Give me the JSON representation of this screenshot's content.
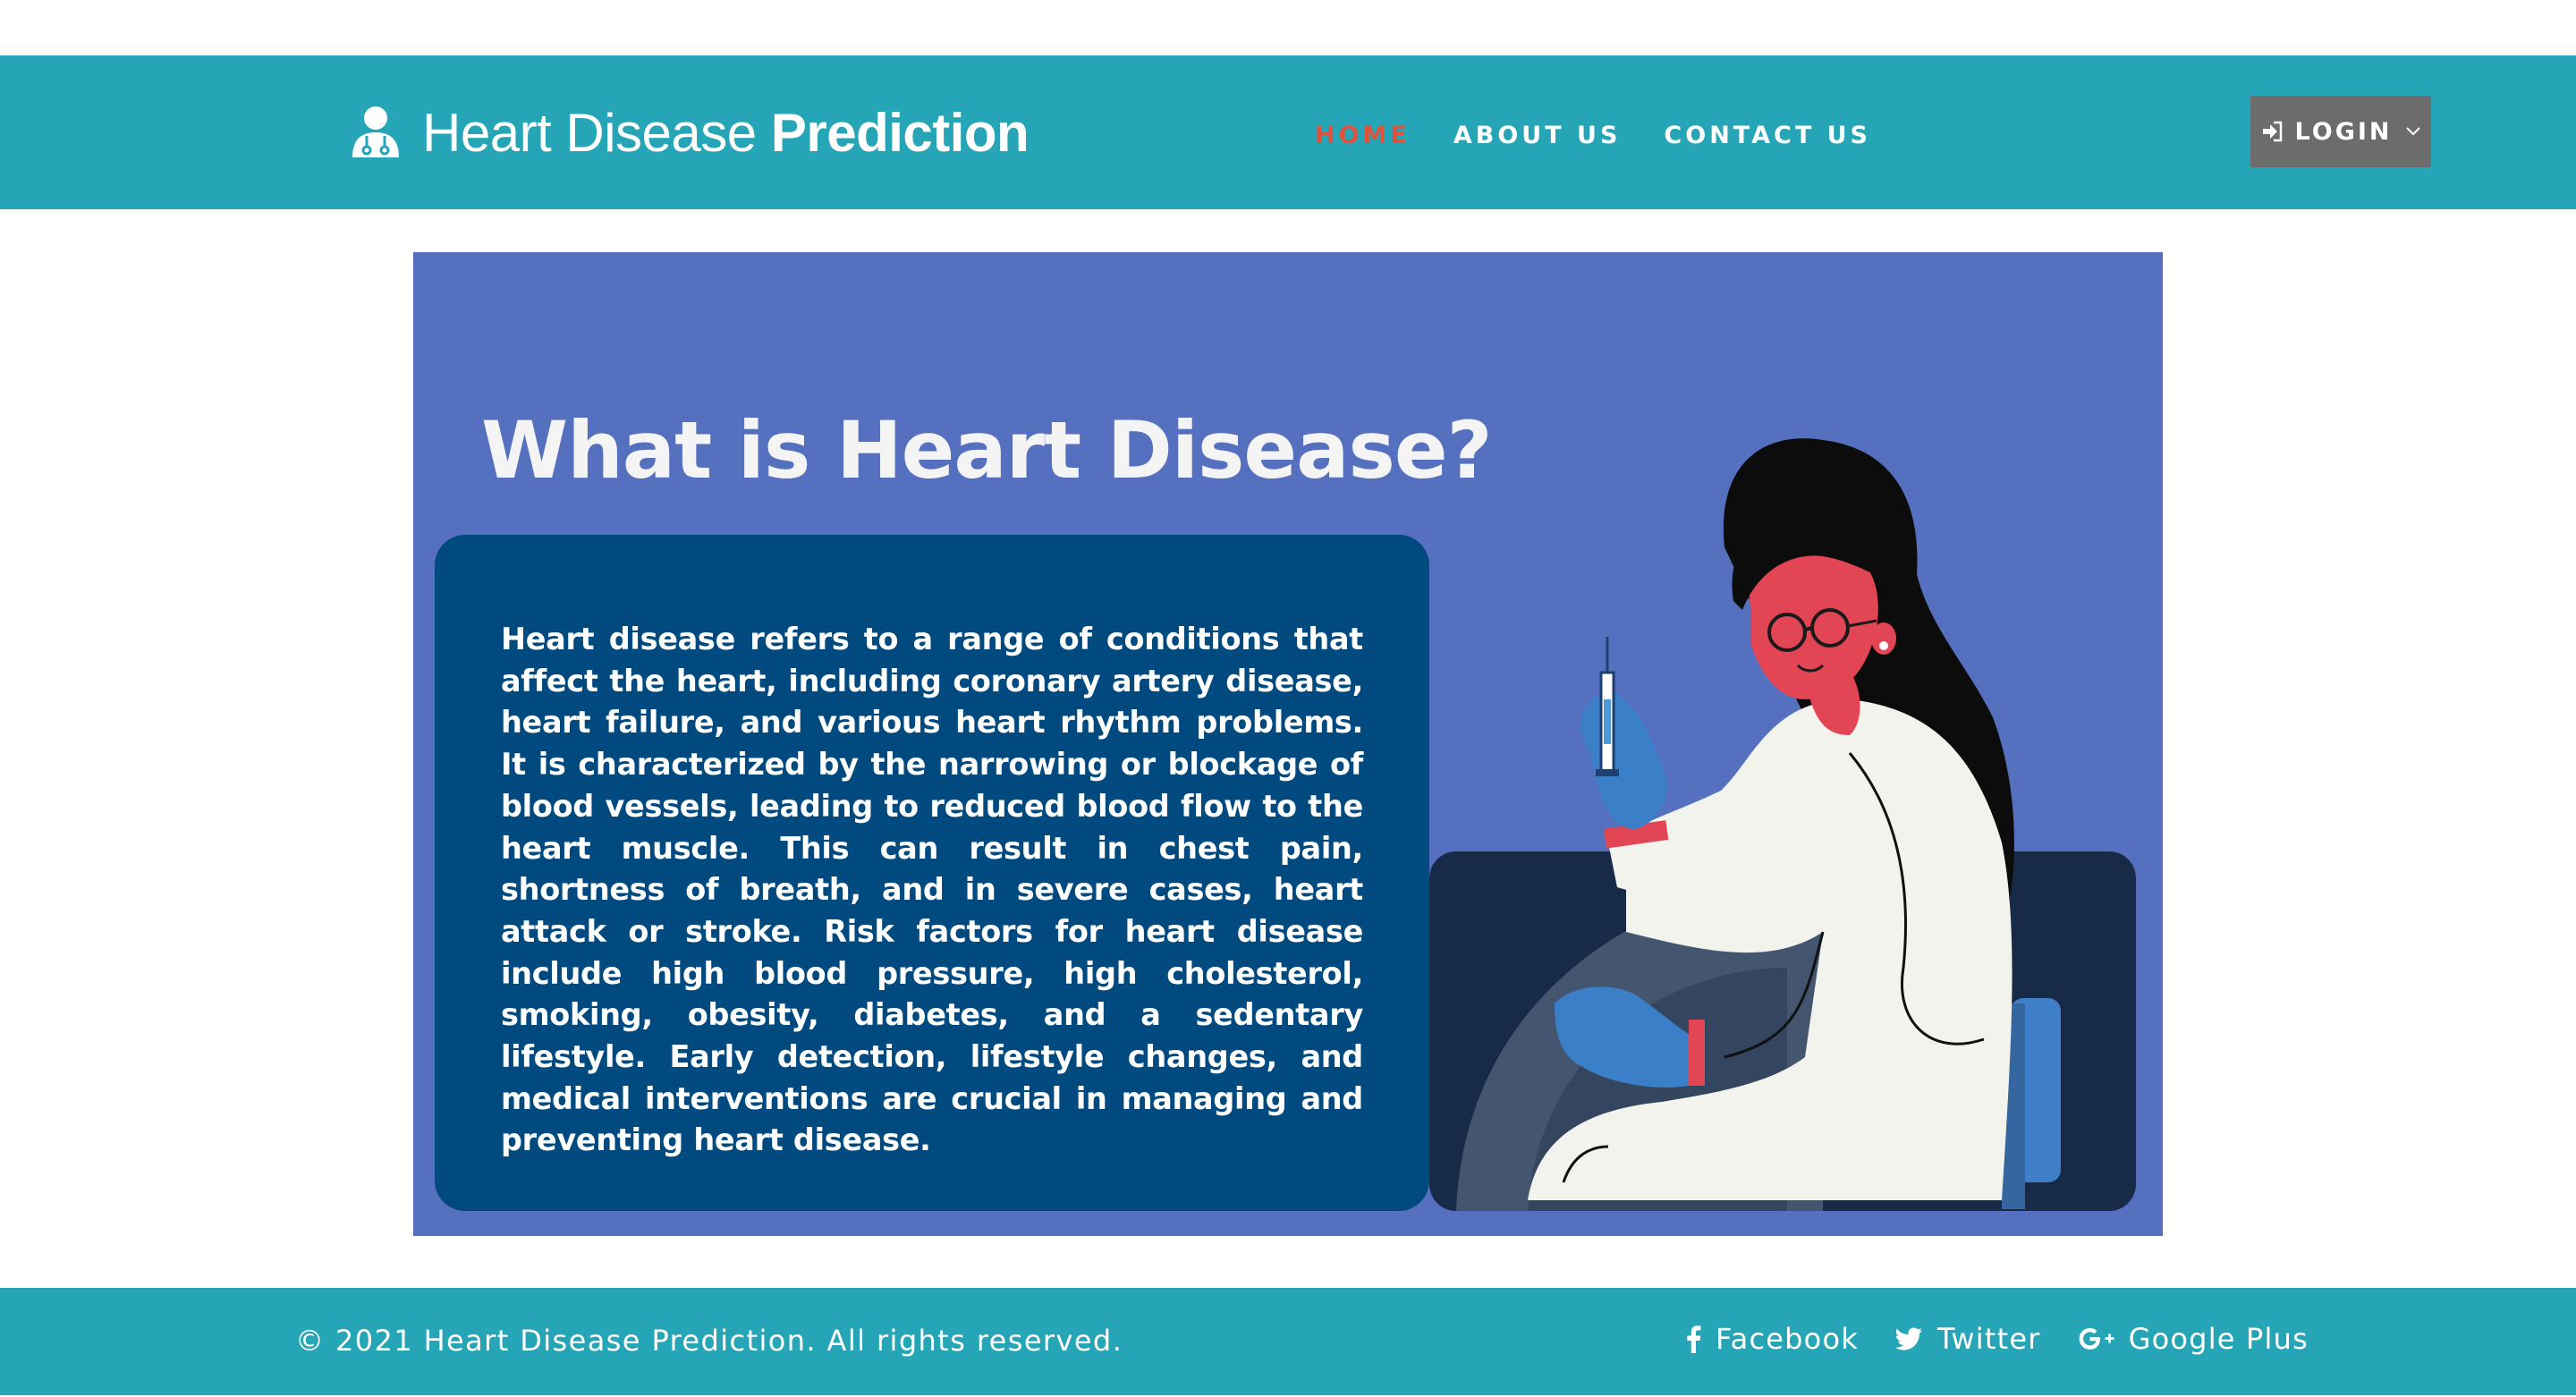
{
  "header": {
    "brand_light": "Heart Disease",
    "brand_bold": "Prediction",
    "brand_icon": "doctor-icon",
    "nav": [
      {
        "label": "HOME",
        "active": true
      },
      {
        "label": "ABOUT US",
        "active": false
      },
      {
        "label": "CONTACT US",
        "active": false
      }
    ],
    "login_label": "LOGIN",
    "login_icon": "sign-in-icon"
  },
  "hero": {
    "title": "What is Heart Disease?",
    "body": "Heart disease refers to a range of conditions that affect the heart, including coronary artery disease, heart failure, and various heart rhythm problems. It is characterized by the narrowing or blockage of blood vessels, leading to reduced blood flow to the heart muscle. This can result in chest pain, shortness of breath, and in severe cases, heart attack or stroke. Risk factors for heart disease include high blood pressure, high cholesterol, smoking, obesity, diabetes, and a sedentary lifestyle. Early detection, lifestyle changes, and medical interventions are crucial in managing and preventing heart disease."
  },
  "footer": {
    "copyright": "© 2021 Heart Disease Prediction. All rights reserved.",
    "social": [
      {
        "label": "Facebook",
        "icon": "facebook-icon"
      },
      {
        "label": "Twitter",
        "icon": "twitter-icon"
      },
      {
        "label": "Google Plus",
        "icon": "google-plus-icon"
      }
    ]
  },
  "colors": {
    "header_bg": "#26a5b7",
    "active_nav": "#e2523a",
    "login_bg": "#6c6c6c",
    "hero_bg": "#5570be",
    "card_bg": "#004a80"
  }
}
